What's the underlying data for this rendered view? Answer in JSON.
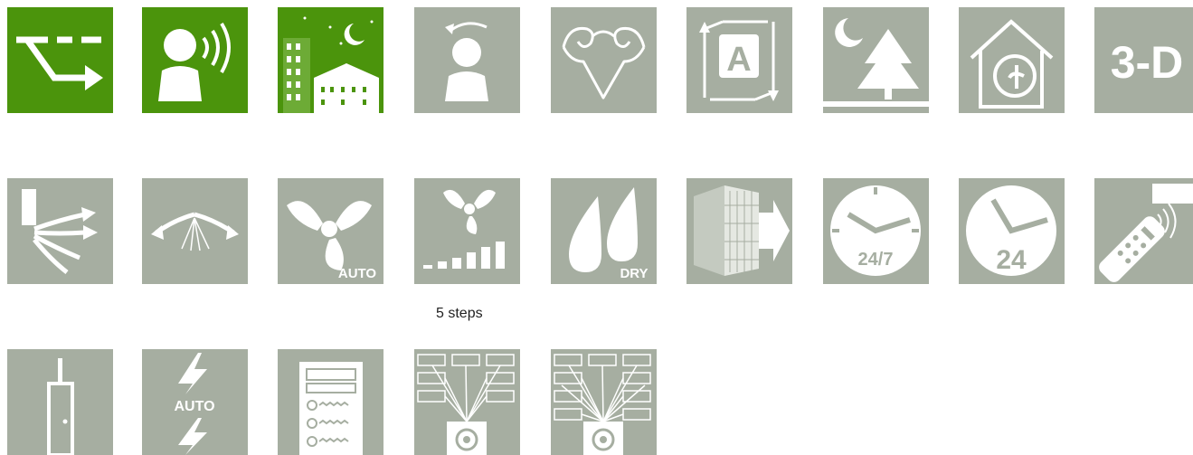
{
  "colors": {
    "active": "#4b940c",
    "inactive": "#a6aea1",
    "glyph": "#ffffff"
  },
  "rows": [
    {
      "icons": [
        {
          "name": "direction-arrow-icon",
          "state": "active"
        },
        {
          "name": "person-sound-icon",
          "state": "active"
        },
        {
          "name": "night-city-icon",
          "state": "active"
        },
        {
          "name": "person-rotate-icon",
          "state": "inactive"
        },
        {
          "name": "muscles-icon",
          "state": "inactive"
        },
        {
          "name": "auto-cycle-icon",
          "state": "inactive",
          "text": "A"
        },
        {
          "name": "night-tree-icon",
          "state": "inactive"
        },
        {
          "name": "quiet-home-icon",
          "state": "inactive"
        },
        {
          "name": "3d-icon",
          "state": "inactive",
          "text": "3-D"
        }
      ]
    },
    {
      "icons": [
        {
          "name": "vertical-swing-icon",
          "state": "inactive"
        },
        {
          "name": "horizontal-swing-icon",
          "state": "inactive"
        },
        {
          "name": "fan-auto-icon",
          "state": "inactive",
          "text": "AUTO"
        },
        {
          "name": "fan-steps-icon",
          "state": "inactive",
          "caption": "5 steps"
        },
        {
          "name": "dry-mode-icon",
          "state": "inactive",
          "text": "DRY"
        },
        {
          "name": "filter-icon",
          "state": "inactive"
        },
        {
          "name": "clock-24-7-icon",
          "state": "inactive",
          "text": "24/7"
        },
        {
          "name": "clock-24-icon",
          "state": "inactive",
          "text": "24"
        },
        {
          "name": "remote-control-icon",
          "state": "inactive"
        }
      ]
    },
    {
      "icons": [
        {
          "name": "door-contact-icon",
          "state": "inactive"
        },
        {
          "name": "auto-restart-icon",
          "state": "inactive",
          "text": "AUTO"
        },
        {
          "name": "control-panel-icon",
          "state": "inactive"
        },
        {
          "name": "multi-unit-network-icon",
          "state": "inactive"
        },
        {
          "name": "multi-unit-network-large-icon",
          "state": "inactive"
        }
      ]
    }
  ]
}
